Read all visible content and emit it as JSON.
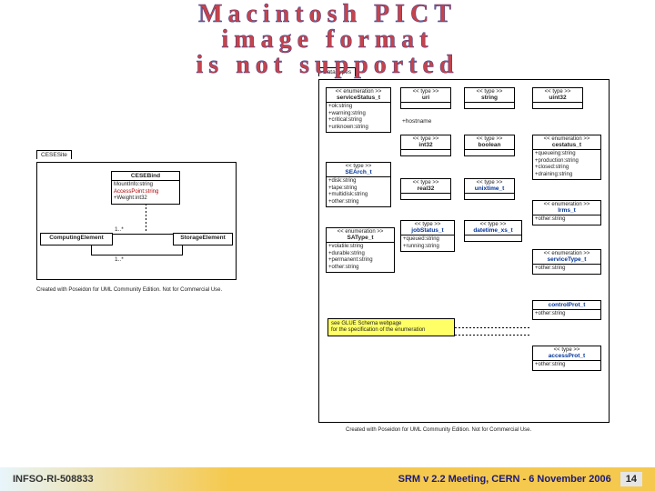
{
  "title_overlay": {
    "line1": "Macintosh PICT",
    "line2": "image format",
    "line3": "is not supported"
  },
  "footer": {
    "left": "INFSO-RI-508833",
    "right": "SRM v 2.2 Meeting, CERN - 6 November 2006",
    "page_number": "14"
  },
  "diagram": {
    "package_name": "DataTypes",
    "credit_left": "Created with Poseidon for UML Community Edition. Not for Commercial Use.",
    "credit_right": "Created with Poseidon for UML Community Edition. Not for Commercial Use.",
    "left": {
      "site_tab": "CESESite",
      "cesebind": {
        "name": "CESEBind",
        "attrs": [
          "MountInfo:string",
          "AccessPoint:string",
          "+Weight:int32"
        ],
        "red_idx": 1
      },
      "ce": "ComputingElement",
      "se": "StorageElement",
      "mult_top": "1..*",
      "mult_bottom": "1..*"
    },
    "right": {
      "serviceStatus": {
        "stereo": "<< enumeration >>",
        "name": "serviceStatus_t",
        "attrs": [
          "+ok:string",
          "+warning:string",
          "+critical:string",
          "+unknown:string"
        ]
      },
      "uri": {
        "stereo": "<< type >>",
        "name": "uri"
      },
      "string": {
        "stereo": "<< type >>",
        "name": "string"
      },
      "uint32": {
        "stereo": "<< type >>",
        "name": "uint32"
      },
      "int32": {
        "stereo": "<< type >>",
        "name": "int32"
      },
      "boolean": {
        "stereo": "<< type >>",
        "name": "boolean"
      },
      "hostname": "+hostname",
      "cestatus": {
        "stereo": "<< enumeration >>",
        "name": "cestatus_t",
        "attrs": [
          "+queueing:string",
          "+production:string",
          "+closed:string",
          "+draining:string"
        ]
      },
      "search": {
        "stereo": "<< type >>",
        "name": "SEArch_t",
        "attrs": [
          "+disk:string",
          "+tape:string",
          "+multidisk:string",
          "+other:string"
        ]
      },
      "real32": {
        "stereo": "<< type >>",
        "name": "real32"
      },
      "unixtime": {
        "stereo": "<< type >>",
        "name": "unixtime_t"
      },
      "lrms": {
        "stereo": "<< enumeration >>",
        "name": "lrms_t",
        "attrs": [
          "+other:string"
        ]
      },
      "satype": {
        "stereo": "<< enumeration >>",
        "name": "SAType_t",
        "attrs": [
          "+volatile:string",
          "+durable:string",
          "+permanent:string",
          "+other:string"
        ]
      },
      "jobStatus": {
        "stereo": "<< type >>",
        "name": "jobStatus_t",
        "attrs": [
          "+queued:string",
          "+running:string"
        ]
      },
      "datetime": {
        "stereo": "<< type >>",
        "name": "datetime_xs_t"
      },
      "serviceType": {
        "stereo": "<< enumeration >>",
        "name": "serviceType_t",
        "attrs": [
          "+other:string"
        ]
      },
      "controlProt": {
        "name": "controlProt_t",
        "attrs": [
          "+other:string"
        ]
      },
      "accessProt": {
        "stereo": "<< type >>",
        "name": "accessProt_t",
        "attrs": [
          "+other:string"
        ]
      }
    },
    "note": {
      "line1": "see GLUE Schema webpage",
      "line2": "for the specification of the enumeration"
    }
  }
}
